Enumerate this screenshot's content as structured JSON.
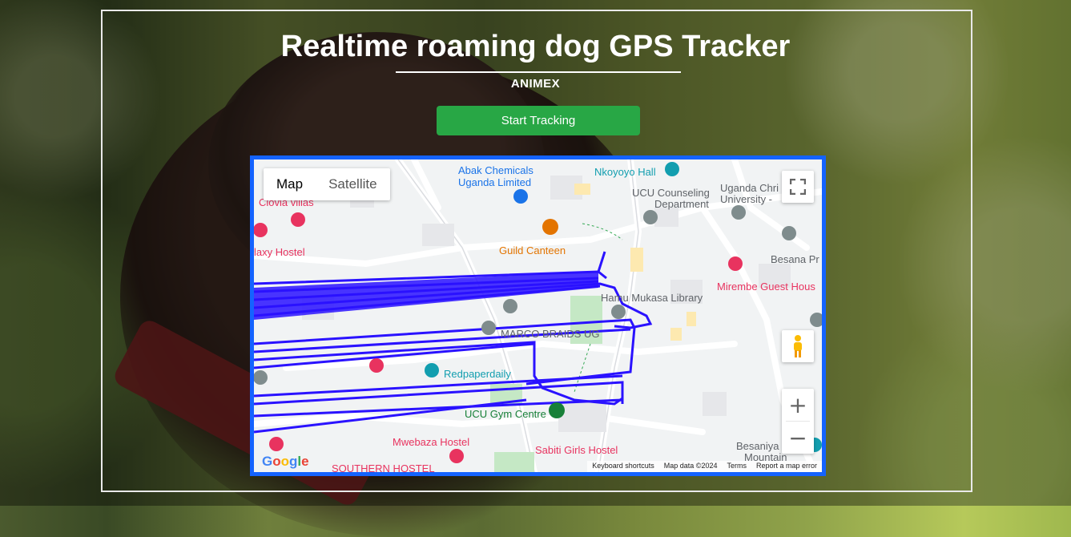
{
  "page": {
    "title": "Realtime roaming dog GPS Tracker",
    "subtitle": "ANIMEX",
    "start_button": "Start Tracking"
  },
  "colors": {
    "accent_green": "#28a745",
    "map_border": "#1463ff",
    "track_line": "#2a12ff"
  },
  "map": {
    "type_controls": [
      "Map",
      "Satellite"
    ],
    "active_type": "Map",
    "fullscreen_icon": "fullscreen-icon",
    "pegman_icon": "pegman-icon",
    "zoom_in": "+",
    "zoom_out": "−",
    "logo": "Google",
    "attribution": [
      "Keyboard shortcuts",
      "Map data ©2024",
      "Terms",
      "Report a map error"
    ],
    "labels": [
      {
        "text": "Abak Chemicals",
        "color": "#1a73e8"
      },
      {
        "text": "Uganda Limited",
        "color": "#1a73e8"
      },
      {
        "text": "Nkoyoyo Hall",
        "color": "#129eaf"
      },
      {
        "text": "UCU Counseling",
        "color": "#5f6368"
      },
      {
        "text": "Department",
        "color": "#5f6368"
      },
      {
        "text": "Uganda Chri",
        "color": "#5f6368"
      },
      {
        "text": "University -",
        "color": "#5f6368"
      },
      {
        "text": "Ciovia villas",
        "color": "#e8335f"
      },
      {
        "text": "laxy Hostel",
        "color": "#e8335f"
      },
      {
        "text": "Guild Canteen",
        "color": "#e37400"
      },
      {
        "text": "Besana Pr",
        "color": "#5f6368"
      },
      {
        "text": "Mirembe Guest Hous",
        "color": "#e8335f"
      },
      {
        "text": "Hamu Mukasa Library",
        "color": "#5f6368"
      },
      {
        "text": "MARCO BRAIDS UG",
        "color": "#5f6368"
      },
      {
        "text": "Redpaperdaily",
        "color": "#129eaf"
      },
      {
        "text": "UCU Gym Centre",
        "color": "#188038"
      },
      {
        "text": "Mwebaza Hostel",
        "color": "#e8335f"
      },
      {
        "text": "Sabiti Girls Hostel",
        "color": "#e8335f"
      },
      {
        "text": "Besaniya",
        "color": "#5f6368"
      },
      {
        "text": "Mountain",
        "color": "#5f6368"
      },
      {
        "text": "SOUTHERN HOSTEL",
        "color": "#e8335f"
      }
    ]
  }
}
